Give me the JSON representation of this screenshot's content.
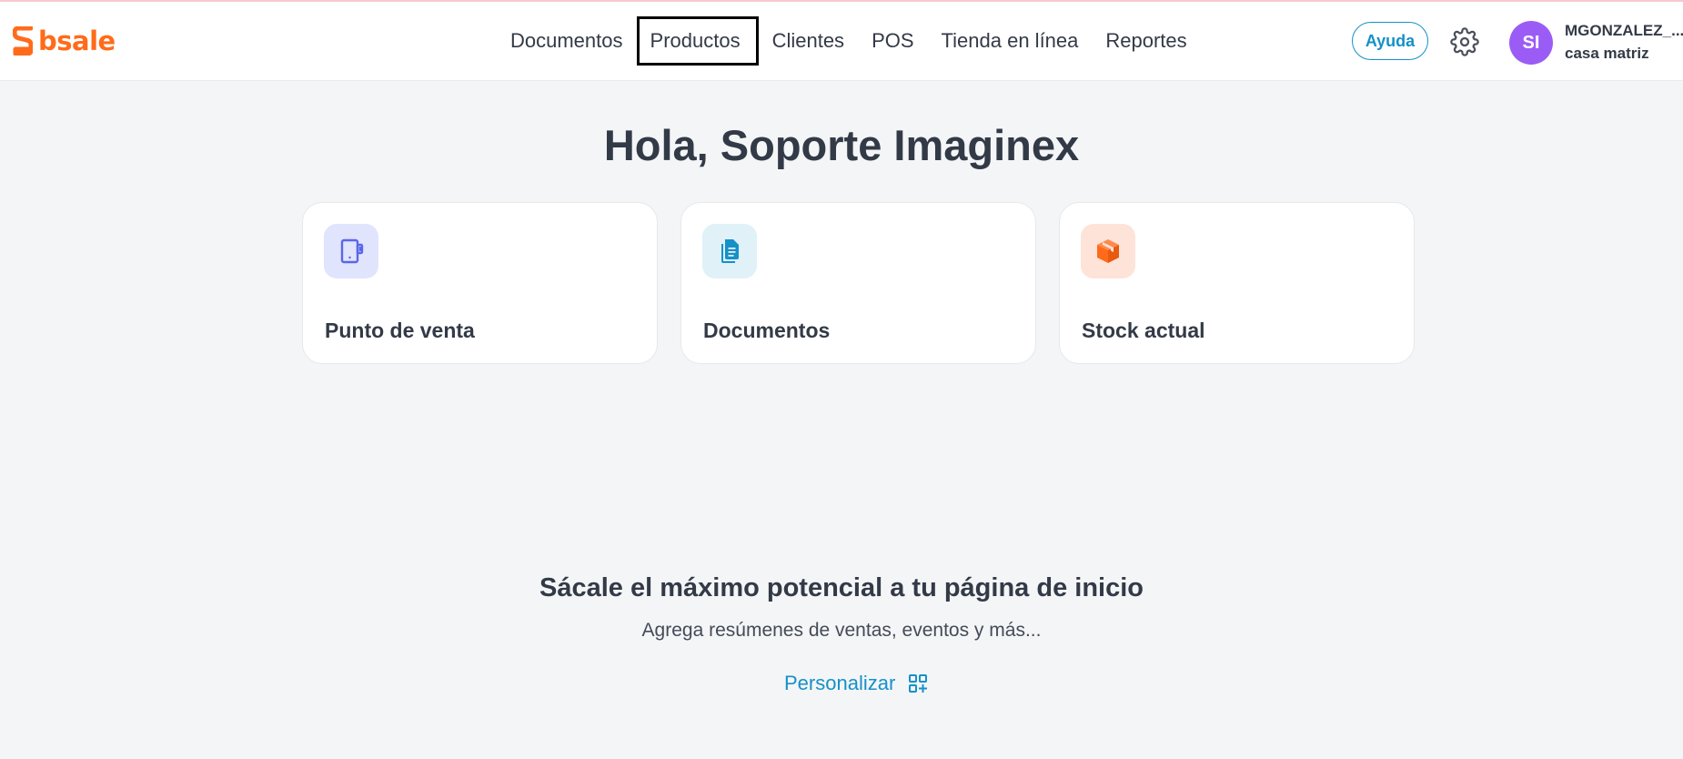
{
  "brand": {
    "name": "bsale",
    "accent": "#ff6b1a"
  },
  "nav": {
    "items": [
      {
        "label": "Documentos"
      },
      {
        "label": "Productos"
      },
      {
        "label": "Clientes"
      },
      {
        "label": "POS"
      },
      {
        "label": "Tienda en línea"
      },
      {
        "label": "Reportes"
      }
    ],
    "active_index": 1
  },
  "header": {
    "help_label": "Ayuda",
    "help_color": "#1591c7",
    "settings_icon": "gear-icon",
    "user": {
      "initials": "SI",
      "avatar_color": "#9b5cf6",
      "name": "MGONZALEZ_...",
      "branch": "casa matriz"
    }
  },
  "main": {
    "greeting": "Hola, Soporte Imaginex",
    "cards": [
      {
        "label": "Punto de venta",
        "icon": "pos-terminal-icon",
        "icon_bg": "#e1e4fd",
        "icon_color": "#5b67e8"
      },
      {
        "label": "Documentos",
        "icon": "document-icon",
        "icon_bg": "#e0f1f8",
        "icon_color": "#1591c7"
      },
      {
        "label": "Stock actual",
        "icon": "box-icon",
        "icon_bg": "#fde3d8",
        "icon_color": "#ff6b1a"
      }
    ],
    "promo": {
      "title": "Sácale el máximo potencial a tu página de inicio",
      "subtitle": "Agrega resúmenes de ventas, eventos y más...",
      "customize_label": "Personalizar",
      "customize_icon": "add-widget-icon"
    }
  }
}
